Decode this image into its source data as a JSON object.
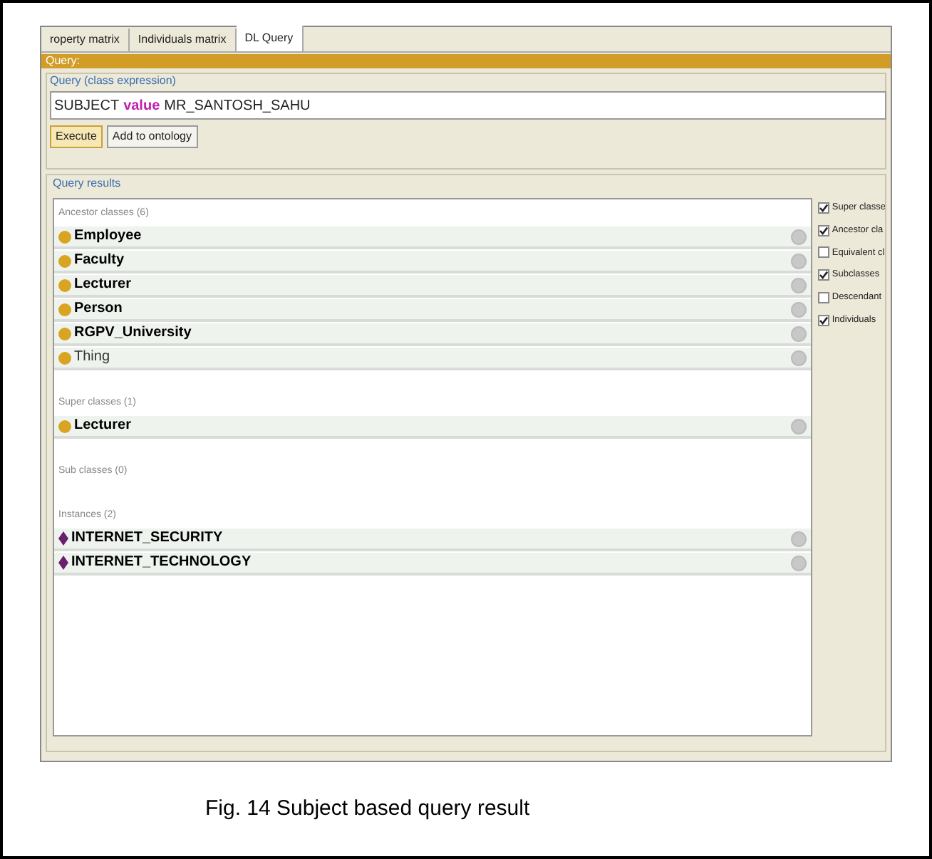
{
  "tabs": [
    {
      "label": "roperty matrix",
      "selected": false
    },
    {
      "label": "Individuals matrix",
      "selected": false
    },
    {
      "label": "DL Query",
      "selected": true
    }
  ],
  "query_bar": {
    "title": "Query:"
  },
  "query_group": {
    "title": "Query (class expression)",
    "expression": [
      {
        "text": "SUBJECT",
        "keyword": false
      },
      {
        "text": "value",
        "keyword": true
      },
      {
        "text": "MR_SANTOSH_SAHU",
        "keyword": false
      }
    ],
    "buttons": [
      {
        "label": "Execute",
        "selected": true
      },
      {
        "label": "Add to ontology",
        "selected": false
      }
    ]
  },
  "results": {
    "title": "Query results",
    "sections": [
      {
        "heading": "Ancestor classes (6)",
        "items": [
          {
            "kind": "class",
            "label": "Employee",
            "bold": true
          },
          {
            "kind": "class",
            "label": "Faculty",
            "bold": true
          },
          {
            "kind": "class",
            "label": "Lecturer",
            "bold": true
          },
          {
            "kind": "class",
            "label": "Person",
            "bold": true
          },
          {
            "kind": "class",
            "label": "RGPV_University",
            "bold": true
          },
          {
            "kind": "class",
            "label": "Thing",
            "bold": false
          }
        ]
      },
      {
        "heading": "Super classes (1)",
        "items": [
          {
            "kind": "class",
            "label": "Lecturer",
            "bold": true
          }
        ]
      },
      {
        "heading": "Sub classes (0)"
      },
      {
        "heading": "Instances (2)",
        "items": [
          {
            "kind": "individual",
            "label": "INTERNET_SECURITY",
            "bold": true
          },
          {
            "kind": "individual",
            "label": "INTERNET_TECHNOLOGY",
            "bold": true
          }
        ]
      }
    ],
    "options": [
      {
        "label": "Super classe",
        "checked": true
      },
      {
        "label": "Ancestor cla",
        "checked": true
      },
      {
        "label": "Equivalent cl",
        "checked": false
      },
      {
        "label": "Subclasses",
        "checked": true
      },
      {
        "label": "Descendant",
        "checked": false
      },
      {
        "label": "Individuals",
        "checked": true
      }
    ]
  },
  "caption": "Fig. 14 Subject based query result"
}
